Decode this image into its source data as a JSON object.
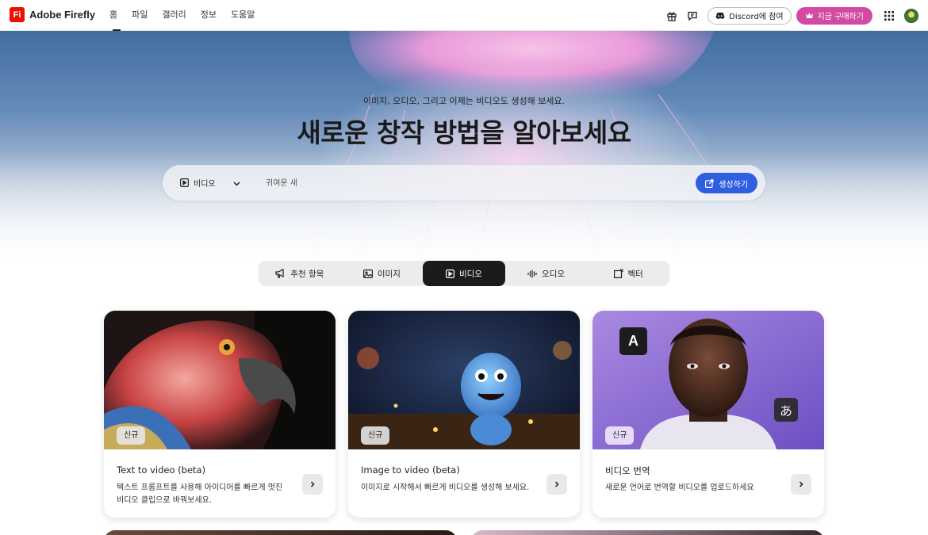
{
  "brand": {
    "logo_mark": "Fi",
    "name": "Adobe Firefly"
  },
  "nav": {
    "links": [
      {
        "label": "홈",
        "active": true
      },
      {
        "label": "파일"
      },
      {
        "label": "갤러리"
      },
      {
        "label": "정보"
      },
      {
        "label": "도움말"
      }
    ],
    "discord_label": "Discord에 참여",
    "buy_label": "지금 구매하기",
    "icons": [
      "gift-icon",
      "feedback-icon",
      "discord-icon",
      "crown-icon",
      "app-grid-icon"
    ]
  },
  "hero": {
    "subtitle": "이미지, 오디오, 그리고 이제는 비디오도 생성해 보세요.",
    "title": "새로운 창작 방법을 알아보세요",
    "mode_label": "비디오",
    "prompt_placeholder": "귀여운 새",
    "generate_label": "생성하기"
  },
  "tabs": [
    {
      "label": "추천 항목",
      "icon": "megaphone-icon"
    },
    {
      "label": "이미지",
      "icon": "image-icon"
    },
    {
      "label": "비디오",
      "icon": "video-icon",
      "active": true
    },
    {
      "label": "오디오",
      "icon": "audio-wave-icon"
    },
    {
      "label": "벡터",
      "icon": "vector-icon"
    }
  ],
  "cards": [
    {
      "badge": "신규",
      "title": "Text to video (beta)",
      "desc": "텍스트 프롬프트를 사용해 아이디어를 빠르게 멋진 비디오 클립으로 바꿔보세요."
    },
    {
      "badge": "신규",
      "title": "Image to video (beta)",
      "desc": "이미지로 시작해서 빠르게 비디오를 생성해 보세요."
    },
    {
      "badge": "신규",
      "title": "비디오 번역",
      "desc": "새로운 언어로 번역할 비디오를 업로드하세요",
      "overlay_left": "A",
      "overlay_right": "あ"
    }
  ],
  "colors": {
    "accent_blue": "#2f5fe0",
    "buy_pink": "#d34aa3",
    "brand_red": "#eb1000"
  }
}
